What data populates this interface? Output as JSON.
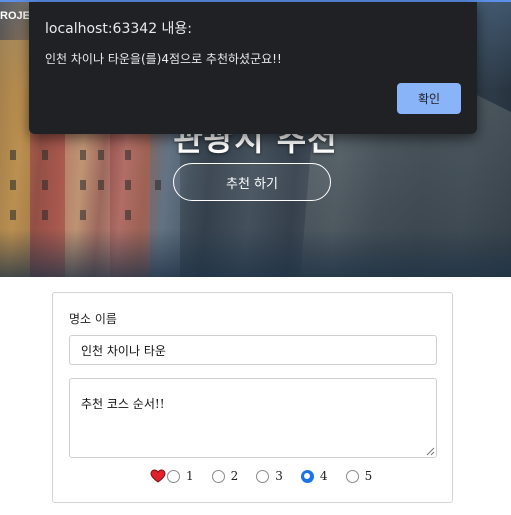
{
  "topbar": {
    "text": "ROJE"
  },
  "hero": {
    "title": "관광지 추천",
    "recommend_button": "추천 하기"
  },
  "form": {
    "place_label": "명소 이름",
    "place_value": "인천 차이나 타운",
    "course_value": "추천 코스 순서!!",
    "rating": {
      "options": [
        "1",
        "2",
        "3",
        "4",
        "5"
      ],
      "selected": "4"
    }
  },
  "dialog": {
    "title": "localhost:63342 내용:",
    "message": "인천 차이나 타운을(를)4점으로 추천하셨군요!!",
    "ok_label": "확인"
  },
  "colors": {
    "dialog_bg": "#202124",
    "dialog_button": "#8ab4f8",
    "radio_checked": "#1a73e8",
    "heart": "#e0202a"
  }
}
